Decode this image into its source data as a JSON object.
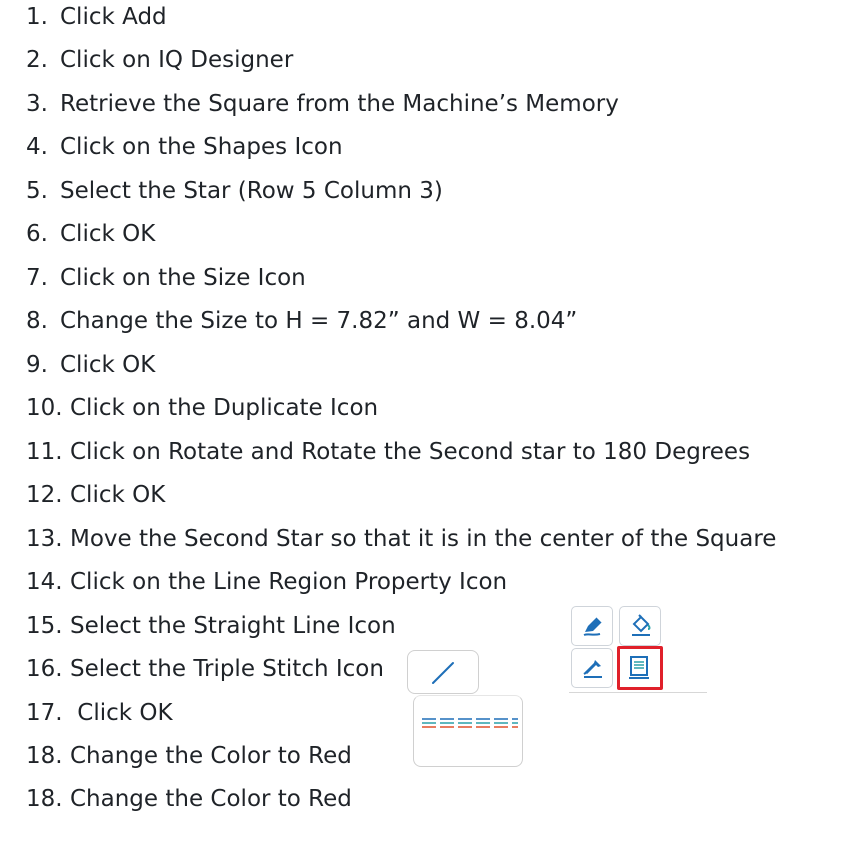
{
  "steps": [
    {
      "num": "1.",
      "text": "Click Add"
    },
    {
      "num": "2.",
      "text": "Click on IQ Designer"
    },
    {
      "num": "3.",
      "text": "Retrieve the Square from the Machine’s Memory"
    },
    {
      "num": "4.",
      "text": "Click on the Shapes Icon"
    },
    {
      "num": "5.",
      "text": "Select the Star (Row 5  Column 3)"
    },
    {
      "num": "6.",
      "text": "Click OK"
    },
    {
      "num": "7.",
      "text": "Click on the Size Icon"
    },
    {
      "num": "8.",
      "text": "Change the Size to H = 7.82” and W = 8.04”"
    },
    {
      "num": "9.",
      "text": "Click OK"
    },
    {
      "num": "10.",
      "text": "Click on the Duplicate Icon"
    },
    {
      "num": "11.",
      "text": "Click on Rotate and Rotate the Second star to 180 Degrees"
    },
    {
      "num": "12.",
      "text": "Click OK"
    },
    {
      "num": "13.",
      "text": "Move the Second Star so that it is in the center of the Square"
    },
    {
      "num": "14.",
      "text": "Click on the Line Region Property Icon"
    },
    {
      "num": "15.",
      "text": "Select the Straight Line Icon"
    },
    {
      "num": "16.",
      "text": "Select the Triple Stitch Icon"
    },
    {
      "num": "17.",
      "text": " Click OK"
    },
    {
      "num": "18.",
      "text": "Change the Color to Red"
    }
  ],
  "icons": {
    "panel": [
      "pen-icon",
      "fill-bucket-icon",
      "eyedropper-icon",
      "line-region-property-icon"
    ],
    "straight_line": "straight-line-icon",
    "triple_stitch": "triple-stitch-icon"
  },
  "colors": {
    "highlight": "#e0202a",
    "icon_blue": "#1e6fb8",
    "icon_teal": "#2aa1a8",
    "stitch_red": "#e0522b"
  }
}
